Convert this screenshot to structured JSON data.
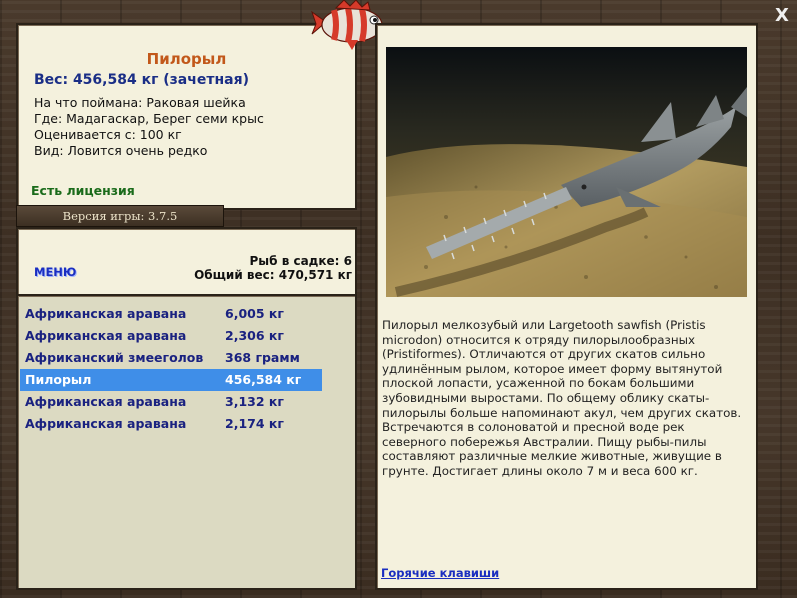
{
  "info": {
    "fish_name": "Пилорыл",
    "weight": "Вес: 456,584 кг (зачетная)",
    "caught_on": "На что поймана: Раковая шейка",
    "location": "Где: Мадагаскар, Берег семи крыс",
    "value": "Оценивается с: 100 кг",
    "kind": "Вид: Ловится очень редко",
    "license": "Есть лицензия"
  },
  "version": "Версия игры: 3.7.5",
  "menu_label": "МЕНЮ",
  "cage": {
    "count": "Рыб в садке: 6",
    "total": "Общий вес: 470,571 кг"
  },
  "fish_list": [
    {
      "name": "Африканская аравана",
      "weight": "6,005 кг",
      "selected": false
    },
    {
      "name": "Африканская аравана",
      "weight": "2,306 кг",
      "selected": false
    },
    {
      "name": "Африканский змееголов",
      "weight": "368 грамм",
      "selected": false
    },
    {
      "name": "Пилорыл",
      "weight": "456,584 кг",
      "selected": true
    },
    {
      "name": "Африканская аравана",
      "weight": "3,132 кг",
      "selected": false
    },
    {
      "name": "Африканская аравана",
      "weight": "2,174 кг",
      "selected": false
    }
  ],
  "description": "Пилорыл мелкозубый или Largetooth sawfish (Pristis microdon) относится к отряду пилорылообразных (Pristiformes). Отличаются от других скатов сильно удлинённым рылом, которое имеет форму вытянутой плоской лопасти, усаженной по бокам большими зубовидными выростами. По общему облику скаты-пилорылы больше напоминают акул, чем других скатов. Встречаются в солоноватой и пресной воде рек северного побережья Австралии. Пищу рыбы-пилы составляют различные мелкие животные, живущие в грунте. Достигает длины около 7 м и веса 600 кг.",
  "hotkeys": "Горячие клавиши",
  "close_label": "X",
  "icons": {
    "close": "close-icon",
    "logo": "fish-logo-icon",
    "photo": "sawfish-photo"
  },
  "colors": {
    "title": "#c2581a",
    "weight": "#1a2e86",
    "license": "#1a6b1a",
    "link": "#1a2ec0",
    "selected_row": "#3f8ee8"
  }
}
